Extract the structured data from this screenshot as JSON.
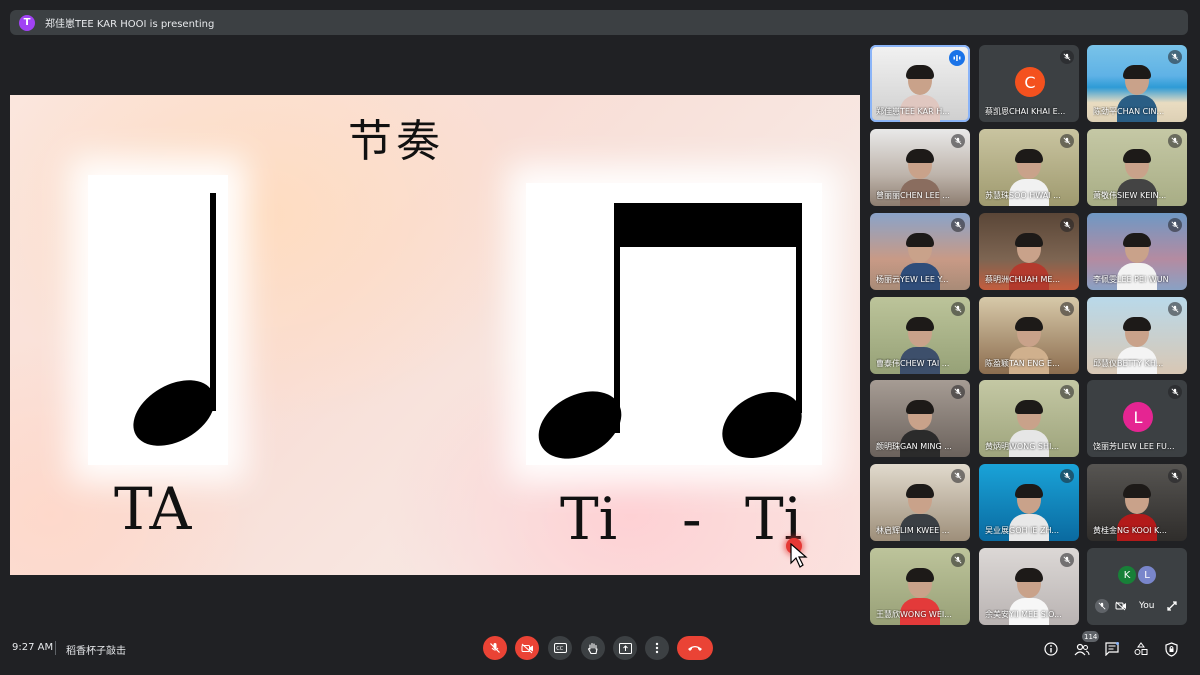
{
  "banner": {
    "avatar_letter": "T",
    "text": "郑佳崽TEE KAR HOOI is presenting"
  },
  "slide": {
    "title": "节奏",
    "left_syllable": "TA",
    "right_syllable_1": "Ti",
    "right_dash": "-",
    "right_syllable_2": "Ti"
  },
  "participants": [
    {
      "name": "郑佳崽TEE KAR H...",
      "speaking": true
    },
    {
      "name": "蔡凯恩CHAI KHAI E...",
      "avatar_letter": "C",
      "avatar_color": "#f4511e"
    },
    {
      "name": "陈劲平CHAN CIN..."
    },
    {
      "name": "曾丽丽CHEN LEE ..."
    },
    {
      "name": "苏慧珠SOO HWAI ..."
    },
    {
      "name": "萧敬伟SIEW KEIN..."
    },
    {
      "name": "杨丽云YEW LEE Y..."
    },
    {
      "name": "蔡明洲CHUAH ME..."
    },
    {
      "name": "李佩雯LEE PEI WUN"
    },
    {
      "name": "曹泰伟CHEW TAI ..."
    },
    {
      "name": "陈盈颖TAN ENG E..."
    },
    {
      "name": "邱慧仪BETTY KH..."
    },
    {
      "name": "颜明珠GAN MING ..."
    },
    {
      "name": "黄炳明WONG SHI..."
    },
    {
      "name": "饶丽芳LIEW LEE FU...",
      "avatar_letter": "L",
      "avatar_color": "#e52592"
    },
    {
      "name": "林启辉LIM KWEE ..."
    },
    {
      "name": "吴业展GOH IE ZH..."
    },
    {
      "name": "黄桂金NG KOOI K..."
    },
    {
      "name": "王慧欣WONG WEI..."
    },
    {
      "name": "余美安YII MEE SIO..."
    }
  ],
  "self_tile": {
    "avatar_letters": [
      "K",
      "L"
    ],
    "avatar_colors": [
      "#188038",
      "#7986cb"
    ],
    "you_label": "You"
  },
  "bottom": {
    "time": "9:27 AM",
    "meeting_name": "稻香杯子敲击",
    "participant_count": "114"
  },
  "colors": {
    "end_call": "#ea4335",
    "muted": "#ea4335",
    "active_outline": "#8ab4f8"
  }
}
